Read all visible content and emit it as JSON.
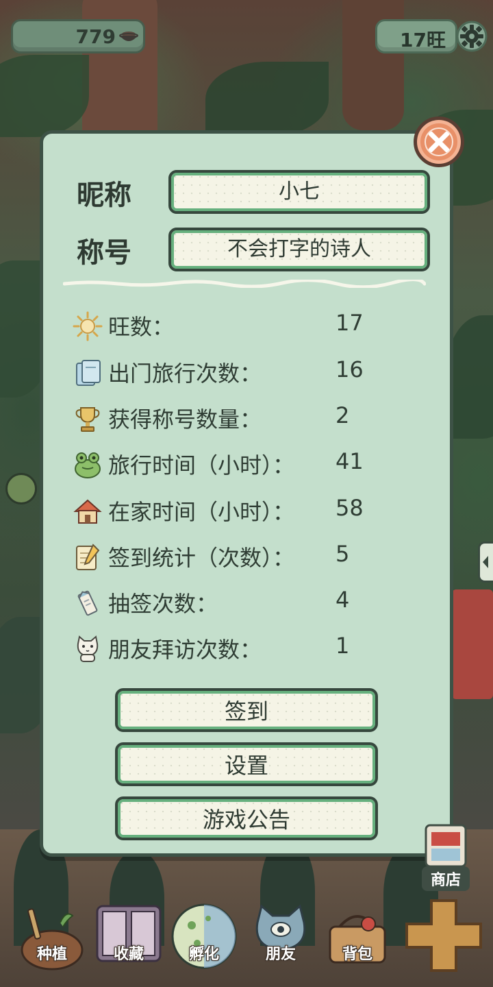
{
  "top_bar": {
    "coins": "779",
    "wang": "17旺",
    "coin_icon": "bowl-icon",
    "settings_icon": "gear-icon"
  },
  "profile": {
    "nickname_label": "昵称",
    "nickname": "小七",
    "title_label": "称号",
    "title": "不会打字的诗人"
  },
  "stats": [
    {
      "icon": "sun-icon",
      "label": "旺数：",
      "value": "17"
    },
    {
      "icon": "postcard-icon",
      "label": "出门旅行次数：",
      "value": "16"
    },
    {
      "icon": "trophy-icon",
      "label": "获得称号数量：",
      "value": "2"
    },
    {
      "icon": "frog-icon",
      "label": "旅行时间（小时）：",
      "value": "41"
    },
    {
      "icon": "house-icon",
      "label": "在家时间（小时）：",
      "value": "58"
    },
    {
      "icon": "notepad-icon",
      "label": "签到统计（次数）：",
      "value": "5"
    },
    {
      "icon": "fortune-slip-icon",
      "label": "抽签次数：",
      "value": "4"
    },
    {
      "icon": "cat-icon",
      "label": "朋友拜访次数：",
      "value": "1"
    }
  ],
  "buttons": {
    "checkin": "签到",
    "settings": "设置",
    "announcement": "游戏公告"
  },
  "side": {
    "shop": "商店"
  },
  "bottom_nav": [
    {
      "label": "种植",
      "icon": "shovel-icon"
    },
    {
      "label": "收藏",
      "icon": "album-icon"
    },
    {
      "label": "孵化",
      "icon": "egg-icon"
    },
    {
      "label": "朋友",
      "icon": "friend-cat-icon"
    },
    {
      "label": "背包",
      "icon": "basket-icon"
    }
  ],
  "colors": {
    "panel_bg": "#c4dfcc",
    "panel_border": "#3d5246",
    "button_inner_border": "#66b07e",
    "close_button": "#e89068"
  }
}
